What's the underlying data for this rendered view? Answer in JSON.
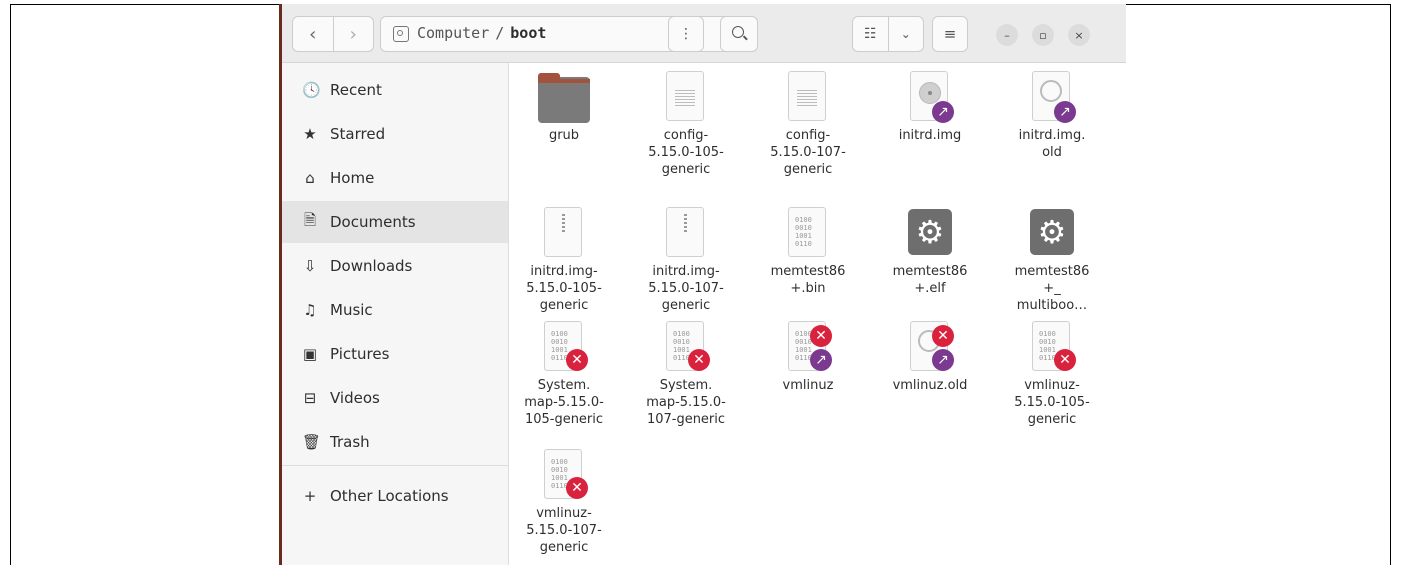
{
  "pathbar": {
    "location": "Computer",
    "separator": "/",
    "current": "boot"
  },
  "toolbar": {
    "back_icon": "‹",
    "forward_icon": "›",
    "path_menu_icon": "⋮",
    "view_list_icon": "☷",
    "view_dropdown_icon": "⌄",
    "main_menu_icon": "≡",
    "minimize_icon": "–",
    "maximize_icon": "▫",
    "close_icon": "×"
  },
  "sidebar": {
    "items": [
      {
        "label": "Recent",
        "icon": "🕓"
      },
      {
        "label": "Starred",
        "icon": "★"
      },
      {
        "label": "Home",
        "icon": "⌂"
      },
      {
        "label": "Documents",
        "icon": "🗎"
      },
      {
        "label": "Downloads",
        "icon": "⇩"
      },
      {
        "label": "Music",
        "icon": "♫"
      },
      {
        "label": "Pictures",
        "icon": "▣"
      },
      {
        "label": "Videos",
        "icon": "⊟"
      },
      {
        "label": "Trash",
        "icon": "🗑"
      }
    ],
    "other": {
      "label": "Other Locations",
      "icon": "+"
    }
  },
  "files": [
    {
      "name": "grub",
      "type": "folder"
    },
    {
      "name": "config-5.15.0-105-generic",
      "line1": "config-",
      "line2": "5.15.0-105-",
      "line3": "generic",
      "type": "text"
    },
    {
      "name": "config-5.15.0-107-generic",
      "line1": "config-",
      "line2": "5.15.0-107-",
      "line3": "generic",
      "type": "text"
    },
    {
      "name": "initrd.img",
      "line1": "initrd.img",
      "type": "disc-link"
    },
    {
      "name": "initrd.img.old",
      "line1": "initrd.img.",
      "line2": "old",
      "type": "history-link"
    },
    {
      "name": "initrd.img-5.15.0-105-generic",
      "line1": "initrd.img-",
      "line2": "5.15.0-105-",
      "line3": "generic",
      "type": "archive"
    },
    {
      "name": "initrd.img-5.15.0-107-generic",
      "line1": "initrd.img-",
      "line2": "5.15.0-107-",
      "line3": "generic",
      "type": "archive"
    },
    {
      "name": "memtest86+.bin",
      "line1": "memtest86",
      "line2": "+.bin",
      "type": "binary"
    },
    {
      "name": "memtest86+.elf",
      "line1": "memtest86",
      "line2": "+.elf",
      "type": "executable"
    },
    {
      "name": "memtest86+_multiboot",
      "line1": "memtest86",
      "line2": "+_",
      "line3": "multiboo…",
      "type": "executable"
    },
    {
      "name": "System.map-5.15.0-105-generic",
      "line1": "System.",
      "line2": "map-5.15.0-",
      "line3": "105-generic",
      "type": "binary-x"
    },
    {
      "name": "System.map-5.15.0-107-generic",
      "line1": "System.",
      "line2": "map-5.15.0-",
      "line3": "107-generic",
      "type": "binary-x"
    },
    {
      "name": "vmlinuz",
      "line1": "vmlinuz",
      "type": "binary-x-link"
    },
    {
      "name": "vmlinuz.old",
      "line1": "vmlinuz.old",
      "type": "history-x-link"
    },
    {
      "name": "vmlinuz-5.15.0-105-generic",
      "line1": "vmlinuz-",
      "line2": "5.15.0-105-",
      "line3": "generic",
      "type": "binary-x"
    },
    {
      "name": "vmlinuz-5.15.0-107-generic",
      "line1": "vmlinuz-",
      "line2": "5.15.0-107-",
      "line3": "generic",
      "type": "binary-x"
    }
  ],
  "binary_glyph": "0100\n0010\n1001\n0110",
  "colors": {
    "link_badge": "#7b3a8f",
    "error_badge": "#d9233e",
    "folder_tab": "#a3523e",
    "folder_body": "#7a7a7a"
  }
}
